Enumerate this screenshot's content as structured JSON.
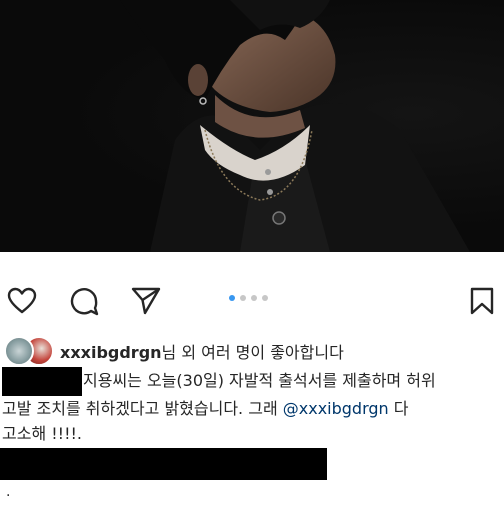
{
  "post": {
    "image_alt": "photo-carousel",
    "carousel": {
      "total": 4,
      "active_index": 0
    }
  },
  "actions": {
    "like_icon": "heart-icon",
    "comment_icon": "comment-icon",
    "share_icon": "send-icon",
    "save_icon": "bookmark-icon"
  },
  "likes": {
    "username": "xxxibgdrgn",
    "text": "님 외 여러 명이 좋아합니다"
  },
  "caption": {
    "line1": "지용씨는 오늘(30일) 자발적 출석서를 제출하며 허위",
    "line2_pre": "고발 조치를 취하겠다고 밝혔습니다. 그래 ",
    "mention": "@xxxibgdrgn",
    "line2_post": " 다",
    "line3": "고소해 !!!!.",
    "trailing": "."
  },
  "colors": {
    "accent_dot": "#3897f0",
    "mention": "#00376b",
    "text": "#262626"
  }
}
